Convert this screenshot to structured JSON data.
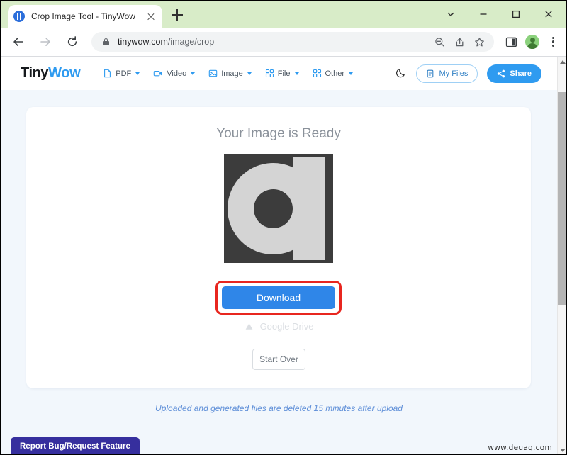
{
  "browser": {
    "tab": {
      "title": "Crop Image Tool - TinyWow",
      "favicon": "tinywow-favicon",
      "close_icon": "close-icon"
    },
    "new_tab_icon": "plus-icon",
    "window_controls": [
      {
        "name": "tab-search-button",
        "icon": "chevron-down-icon"
      },
      {
        "name": "minimize-button",
        "icon": "minimize-icon"
      },
      {
        "name": "maximize-button",
        "icon": "maximize-icon"
      },
      {
        "name": "close-window-button",
        "icon": "close-icon"
      }
    ],
    "nav": {
      "back_icon": "back-arrow-icon",
      "forward_icon": "forward-arrow-icon",
      "reload_icon": "reload-icon"
    },
    "omnibox": {
      "lock_icon": "lock-icon",
      "url_domain": "tinywow.com",
      "url_path": "/image/crop",
      "icons": [
        {
          "name": "zoom-out-icon"
        },
        {
          "name": "share-page-icon"
        },
        {
          "name": "bookmark-star-icon"
        }
      ]
    },
    "toolbar_right": [
      {
        "name": "side-panel-icon"
      },
      {
        "name": "profile-avatar"
      },
      {
        "name": "chrome-menu-icon"
      }
    ]
  },
  "site": {
    "logo": {
      "part1": "Tiny",
      "part2": "Wow"
    },
    "nav_items": [
      {
        "label": "PDF",
        "icon": "document-icon"
      },
      {
        "label": "Video",
        "icon": "video-camera-icon"
      },
      {
        "label": "Image",
        "icon": "image-icon"
      },
      {
        "label": "File",
        "icon": "grid-icon"
      },
      {
        "label": "Other",
        "icon": "grid-icon"
      }
    ],
    "dark_mode_toggle": {
      "icon": "moon-icon"
    },
    "my_files": {
      "label": "My Files",
      "icon": "files-icon"
    },
    "share": {
      "label": "Share",
      "icon": "share-nodes-icon"
    }
  },
  "main": {
    "title": "Your Image is Ready",
    "preview": {
      "name": "cropped-image-preview"
    },
    "download_button": {
      "label": "Download"
    },
    "google_drive": {
      "label": "Google Drive",
      "icon": "google-drive-icon"
    },
    "start_over_button": {
      "label": "Start Over"
    },
    "notice": "Uploaded and generated files are deleted 15 minutes after upload"
  },
  "footer": {
    "report_bug": {
      "label": "Report Bug/Request Feature"
    },
    "watermark": "www.deuaq.com"
  },
  "colors": {
    "accent_blue": "#2f9bf0",
    "download_blue": "#2f86e8",
    "highlight_red": "#e8261f",
    "report_purple": "#362f9e",
    "tabstrip_green": "#d8ecc8",
    "page_bg": "#f2f7fc"
  }
}
